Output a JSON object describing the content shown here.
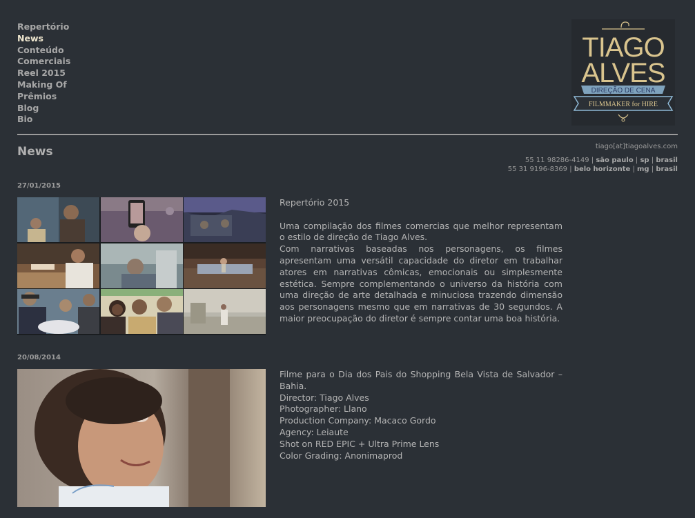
{
  "nav": {
    "items": [
      {
        "label": "Repertório",
        "active": false
      },
      {
        "label": "News",
        "active": true
      },
      {
        "label": "Conteúdo",
        "active": false
      },
      {
        "label": "Comerciais",
        "active": false
      },
      {
        "label": "Reel 2015",
        "active": false
      },
      {
        "label": "Making Of",
        "active": false
      },
      {
        "label": "Prêmios",
        "active": false
      },
      {
        "label": "Blog",
        "active": false
      },
      {
        "label": "Bio",
        "active": false
      }
    ]
  },
  "logo": {
    "line1": "TIAGO",
    "line2": "ALVES",
    "ribbon": "DIREÇÃO DE CENA",
    "tagline": "FILMMAKER for HIRE"
  },
  "page": {
    "title": "News"
  },
  "contact": {
    "email": "tiago[at]tiagoalves.com",
    "phone1": "55 11 98286-4149",
    "city1": "são paulo",
    "state1": "sp",
    "country1": "brasil",
    "phone2": "55 31 9196-8369",
    "city2": "belo horizonte",
    "state2": "mg",
    "country2": "brasil",
    "sep": "|"
  },
  "posts": [
    {
      "date": "27/01/2015",
      "title": "Repertório 2015",
      "paragraph1": "Uma compilação dos filmes comercias que melhor representam o estilo de direção de Tiago Alves.",
      "paragraph2": "Com narrativas baseadas nos personagens, os filmes apresentam uma versátil capacidade do diretor em trabalhar atores em narrativas cômicas, emocionais ou simplesmente estética. Sempre complementando o universo da história com uma direção de arte detalhada e minuciosa trazendo dimensão aos personagens mesmo que em narrativas de 30 segundos. A maior preocupação do diretor é sempre contar uma boa história."
    },
    {
      "date": "20/08/2014",
      "lines": [
        "Filme para o Dia dos Pais do Shopping Bela Vista de Salvador – Bahia.",
        "Director: Tiago Alves",
        "Photographer: Llano",
        "Production Company: Macaco Gordo",
        "Agency: Leiaute",
        "Shot on RED EPIC + Ultra Prime Lens",
        "Color Grading: Anonimaprod"
      ]
    }
  ],
  "colors": {
    "background": "#2b3036",
    "nav_active": "#efe7cf",
    "logo_gold": "#d9c48e",
    "ribbon_blue": "#8fb9d6"
  }
}
